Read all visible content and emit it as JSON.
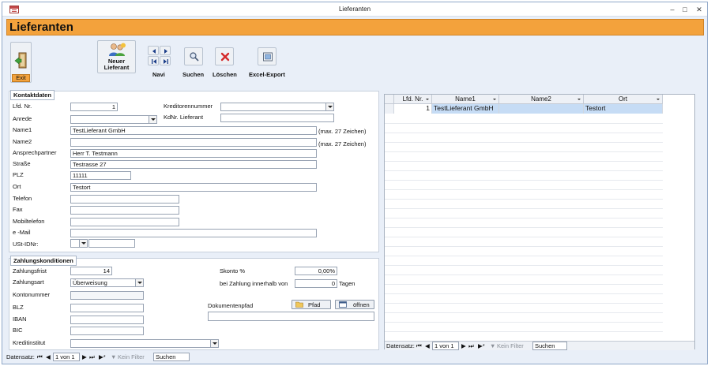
{
  "window": {
    "title": "Lieferanten"
  },
  "header": {
    "title": "Lieferanten"
  },
  "toolbar": {
    "exit": "Exit",
    "new_supplier": [
      "Neuer",
      "Lieferant"
    ],
    "navi": "Navi",
    "search": "Suchen",
    "delete": "Löschen",
    "excel": "Excel-Export"
  },
  "contact": {
    "title": "Kontaktdaten",
    "lfd_nr": {
      "label": "Lfd. Nr.",
      "value": "1"
    },
    "anrede": {
      "label": "Anrede",
      "value": ""
    },
    "name1": {
      "label": "Name1",
      "value": "TestLieferant GmbH",
      "hint": "(max. 27 Zeichen)"
    },
    "name2": {
      "label": "Name2",
      "value": "",
      "hint": "(max. 27 Zeichen)"
    },
    "ansprechpartner": {
      "label": "Ansprechpartner",
      "value": "Herr T. Testmann"
    },
    "strasse": {
      "label": "Straße",
      "value": "Testrasse 27"
    },
    "plz": {
      "label": "PLZ",
      "value": "11111"
    },
    "ort": {
      "label": "Ort",
      "value": "Testort"
    },
    "telefon": {
      "label": "Telefon",
      "value": ""
    },
    "fax": {
      "label": "Fax",
      "value": ""
    },
    "mobil": {
      "label": "Mobiltelefon",
      "value": ""
    },
    "email": {
      "label": "e -Mail",
      "value": ""
    },
    "ust": {
      "label": "USt-IDNr:",
      "value": ""
    },
    "kreditorennummer": {
      "label": "Kreditorennummer",
      "value": ""
    },
    "kdnr": {
      "label": "KdNr. Lieferant",
      "value": ""
    }
  },
  "payment": {
    "title": "Zahlungskonditionen",
    "frist": {
      "label": "Zahlungsfrist",
      "value": "14"
    },
    "art": {
      "label": "Zahlungsart",
      "value": "Überweisung"
    },
    "konto": {
      "label": "Kontonummer",
      "value": ""
    },
    "blz": {
      "label": "BLZ",
      "value": ""
    },
    "iban": {
      "label": "IBAN",
      "value": ""
    },
    "bic": {
      "label": "BIC",
      "value": ""
    },
    "kreditinstitut": {
      "label": "Kreditinstitut",
      "value": ""
    },
    "skonto": {
      "label": "Skonto %",
      "value": "0,00%"
    },
    "innerhalb": {
      "label": "bei Zahlung innerhalb von",
      "value": "0",
      "unit": "Tagen"
    },
    "dokpfad": {
      "label": "Dokumentenpfad",
      "value": ""
    },
    "pfad_btn": "Pfad",
    "oeffnen_btn": "öffnen"
  },
  "grid": {
    "columns": [
      "Lfd. Nr.",
      "Name1",
      "Name2",
      "Ort"
    ],
    "rows": [
      {
        "lfd": "1",
        "name1": "TestLieferant GmbH",
        "name2": "",
        "ort": "Testort"
      }
    ]
  },
  "recordnav": {
    "label": "Datensatz:",
    "position": "1 von 1",
    "filter": "Kein Filter",
    "search": "Suchen"
  },
  "colors": {
    "accent": "#f3a23c",
    "selected_row": "#c6dcf5"
  }
}
